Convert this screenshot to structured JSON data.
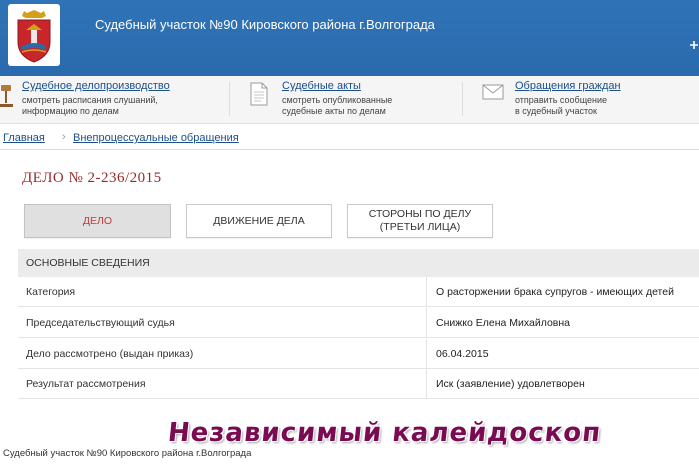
{
  "header": {
    "site_title": "Судебный участок №90 Кировского района г.Волгограда",
    "emblem_icon": "volgograd-coat-of-arms-icon",
    "colors": {
      "bar": "#2f73b6",
      "text": "#ffffff"
    }
  },
  "topnav": {
    "items": [
      {
        "icon": "gavel-icon",
        "label": "Судебное делопроизводство",
        "desc": [
          "смотреть расписания слушаний,",
          "информацию по делам"
        ]
      },
      {
        "icon": "document-icon",
        "label": "Судебные акты",
        "desc": [
          "смотреть опубликованные",
          "судебные акты по делам"
        ]
      },
      {
        "icon": "envelope-icon",
        "label": "Обращения граждан",
        "desc": [
          "отправить сообщение",
          "в судебный участок"
        ]
      }
    ]
  },
  "breadcrumb": {
    "home": "Главная",
    "separator": "›",
    "current": "Внепроцессуальные обращения"
  },
  "case": {
    "title": "ДЕЛО № 2-236/2015",
    "title_color": "#9a2a2a"
  },
  "tabs": [
    {
      "label": "ДЕЛО",
      "active": true
    },
    {
      "label": "ДВИЖЕНИЕ ДЕЛА",
      "active": false
    },
    {
      "label_line1": "СТОРОНЫ ПО ДЕЛУ",
      "label_line2": "(ТРЕТЬИ ЛИЦА)",
      "active": false
    }
  ],
  "section": {
    "title": "ОСНОВНЫЕ СВЕДЕНИЯ",
    "rows": [
      {
        "key": "Категория",
        "value": "О расторжении брака супругов - имеющих детей"
      },
      {
        "key": "Председательствующий судья",
        "value": "Снижко Елена Михайловна"
      },
      {
        "key": "Дело рассмотрено (выдан приказ)",
        "value": "06.04.2015"
      },
      {
        "key": "Результат рассмотрения",
        "value": "Иск (заявление) удовлетворен"
      }
    ]
  },
  "footer": {
    "text": "Судебный участок №90 Кировского района г.Волгограда"
  },
  "watermark": {
    "text": "Независимый калейдоскоп",
    "color": "#7a0a52"
  }
}
